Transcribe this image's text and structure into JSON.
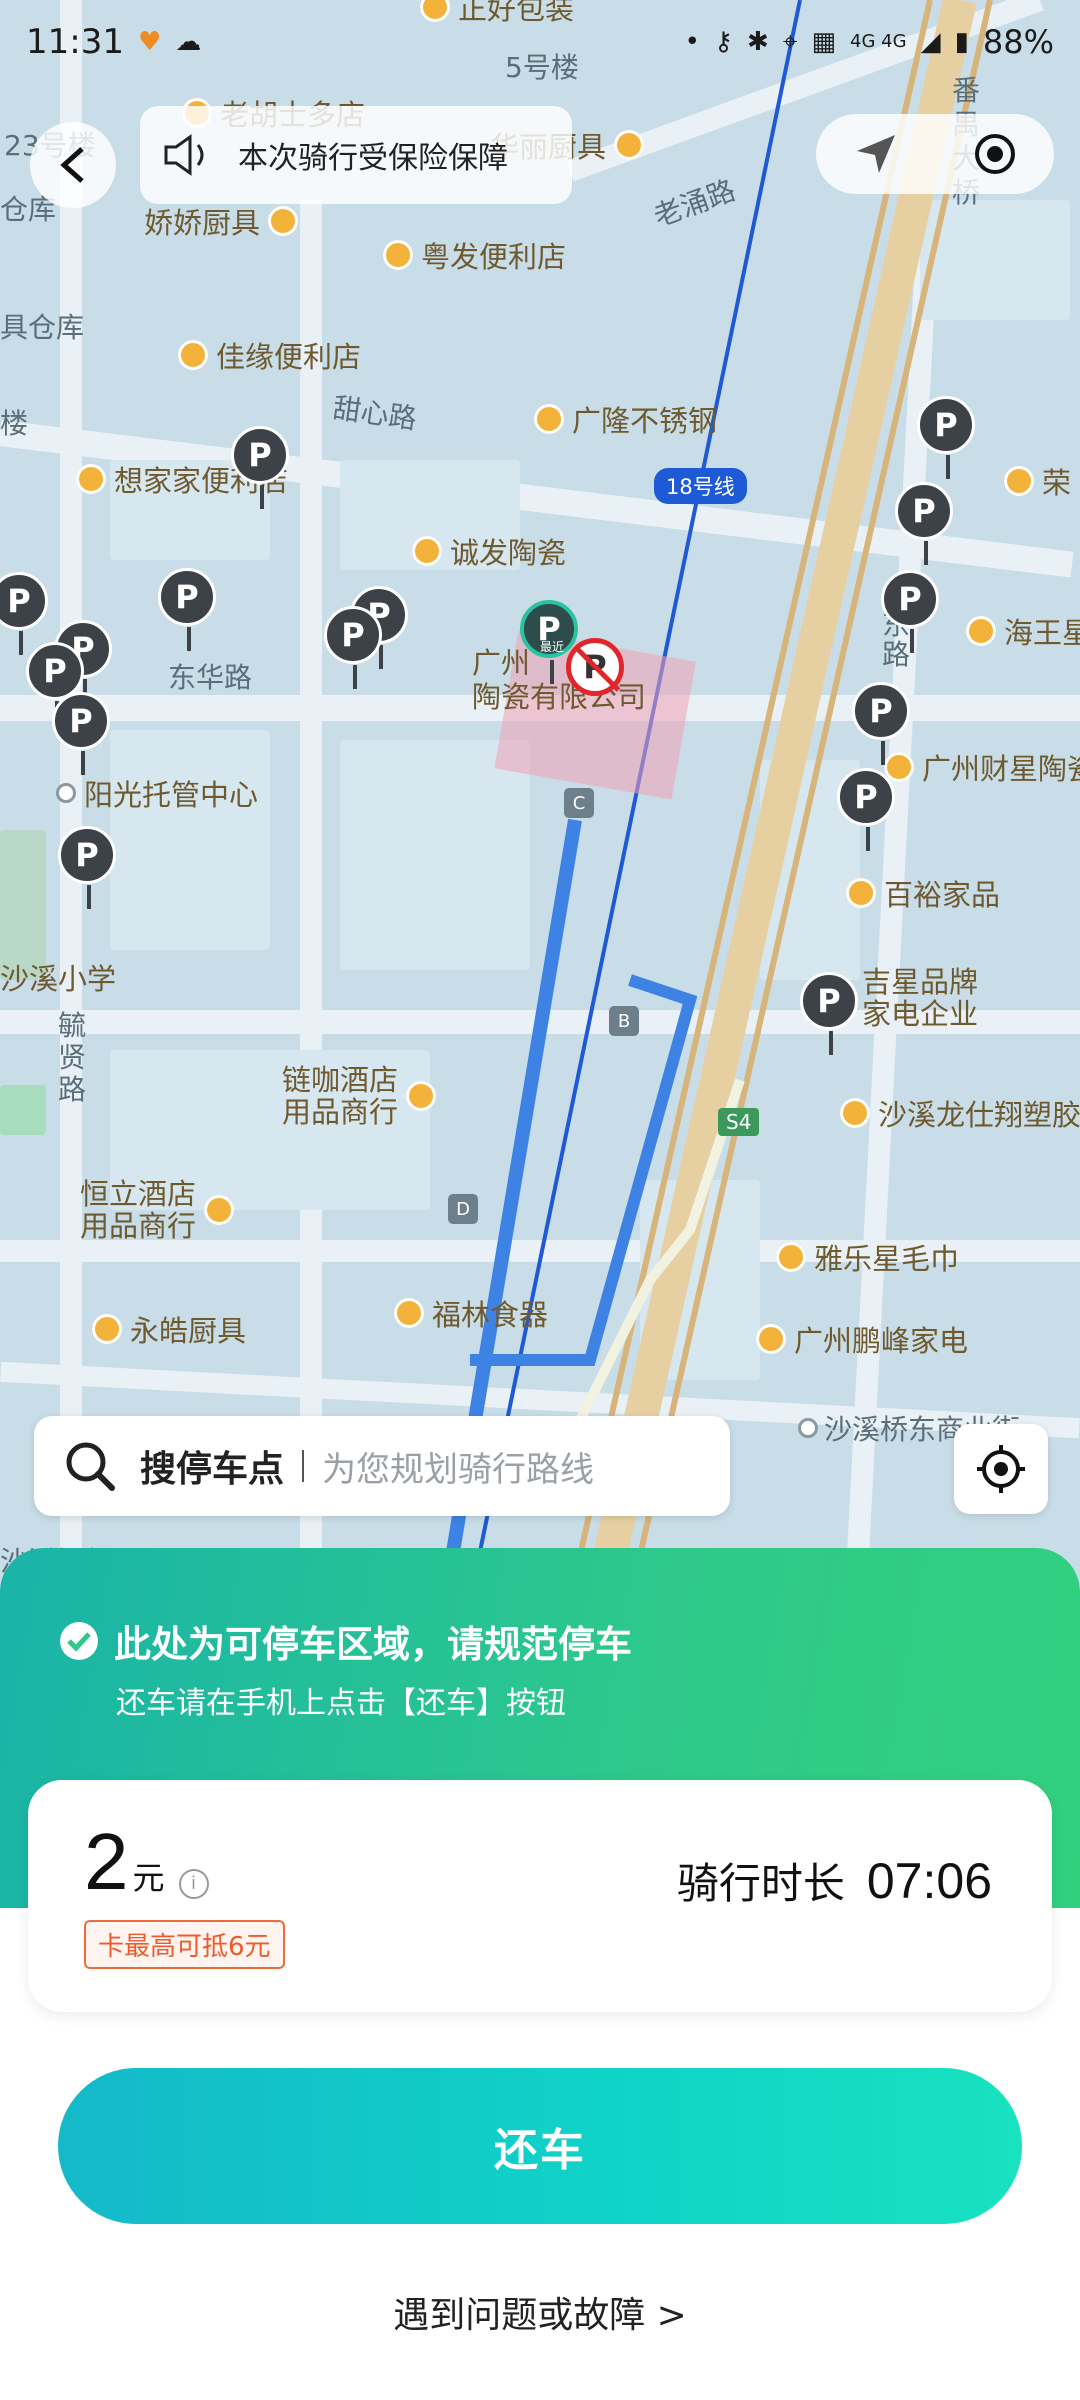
{
  "status_bar": {
    "time": "11:31",
    "network": "4G 4G",
    "battery": "88%"
  },
  "top": {
    "insurance_text": "本次骑行受保险保障"
  },
  "map": {
    "labels": {
      "building5": "5号楼",
      "bldg23": "23号楼",
      "warehouse": "仓库",
      "warehouse2": "具仓库",
      "lou": "楼",
      "laoyong_road": "老涌路",
      "tianxin_road": "甜心路",
      "donghua_road": "东华路",
      "line18": "18号线",
      "dong_lu": "东路",
      "fanyu_bridge": "番禺大桥",
      "shunxian_road": "毓贤路",
      "shaxi_bank": "沙溪银行",
      "shaxi_bridge_east": "沙溪桥东商业街",
      "s4": "S4",
      "gz_taoci_1": "广州",
      "gz_taoci_2": "陶瓷有限公司",
      "nearest_tag": "最近",
      "station_c": "C",
      "station_b": "B",
      "station_d": "D"
    },
    "pois": {
      "zhenghao": "正好包装",
      "laohu": "老胡士多店",
      "huanan": "华丽厨具",
      "jiaojiao": "娇娇厨具",
      "yuefa": "粤发便利店",
      "jiayuan": "佳缘便利店",
      "guanglong": "广隆不锈钢",
      "xiangjia": "想家家便利店",
      "chengfa": "诚发陶瓷",
      "rong": "荣",
      "haiwang": "海王星",
      "caixing": "广州财星陶瓷",
      "yangguang": "阳光托管中心",
      "baiyu": "百裕家品",
      "shaxi_school": "沙溪小学",
      "jixing_1": "吉星品牌",
      "jixing_2": "家电企业",
      "lianka_1": "链咖酒店",
      "lianka_2": "用品商行",
      "longshi": "沙溪龙仕翔塑胶",
      "hengli_1": "恒立酒店",
      "hengli_2": "用品商行",
      "yale": "雅乐星毛巾",
      "yonghao": "永皓厨具",
      "fulin": "福林食器",
      "pengfeng": "广州鹏峰家电"
    }
  },
  "search": {
    "label": "搜停车点",
    "placeholder": "为您规划骑行路线"
  },
  "panel": {
    "parking_title": "此处为可停车区域，请规范停车",
    "parking_sub": "还车请在手机上点击【还车】按钮",
    "price": "2",
    "price_unit": "元",
    "coupon": "卡最高可抵6元",
    "ride_time_label": "骑行时长",
    "ride_time": "07:06",
    "return_button": "还车",
    "problem_link": "遇到问题或故障 >"
  },
  "colors": {
    "accent_green": "#2ec98a",
    "accent_teal": "#15b9c9",
    "map_bg": "#c9dde8",
    "pin_dark": "#3d4248",
    "forbidden_red": "#e0262b"
  }
}
